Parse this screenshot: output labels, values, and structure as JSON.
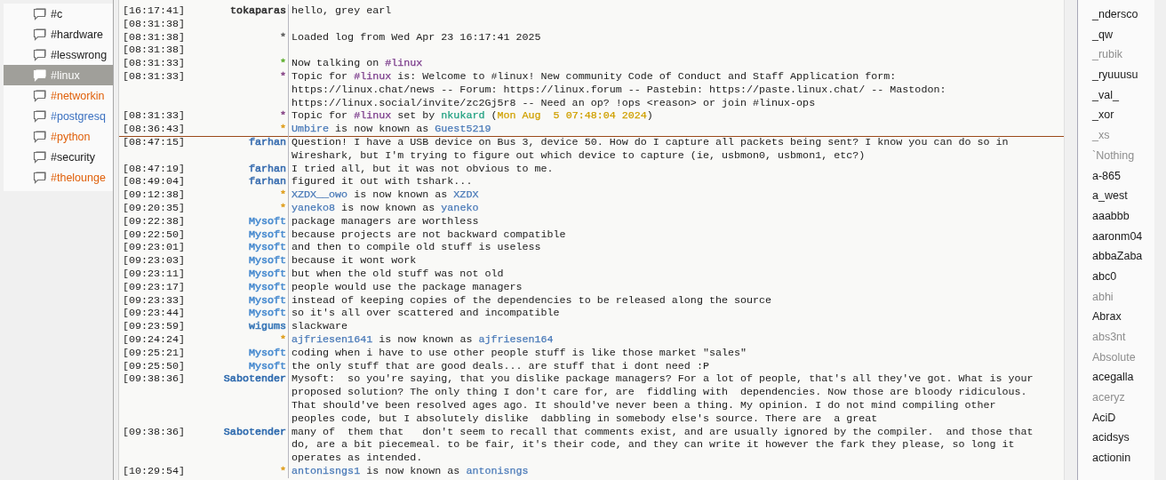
{
  "channels": [
    {
      "name": "#c",
      "selected": false
    },
    {
      "name": "#hardware",
      "selected": false
    },
    {
      "name": "#lesswrong",
      "selected": false
    },
    {
      "name": "#linux",
      "selected": true
    },
    {
      "name": "#networkin",
      "selected": false,
      "color": "#e0600a"
    },
    {
      "name": "#postgresq",
      "selected": false,
      "color": "#3a70c0"
    },
    {
      "name": "#python",
      "selected": false,
      "color": "#e0600a"
    },
    {
      "name": "#security",
      "selected": false
    },
    {
      "name": "#thelounge",
      "selected": false,
      "color": "#e0600a"
    }
  ],
  "chat": {
    "rows": [
      {
        "time": "[16:17:41]",
        "nick": {
          "name": "tokaparas",
          "color": "#303030"
        },
        "message": [
          {
            "text": "hello, grey earl"
          }
        ],
        "read_marker": false
      },
      {
        "time": "[08:31:38]",
        "read_marker": false
      },
      {
        "time": "[08:31:38]",
        "nick": {
          "name": "*",
          "color": "#606060"
        },
        "message": [
          {
            "text": "Loaded log from Wed Apr 23 16:17:41 2025"
          }
        ],
        "read_marker": false
      },
      {
        "time": "[08:31:38]",
        "read_marker": false
      },
      {
        "time": "[08:31:33]",
        "nick": {
          "name": "*",
          "color": "#60b030"
        },
        "message": [
          {
            "text": "Now talking on "
          },
          {
            "text": "#linux",
            "color": "#7a3a8a"
          }
        ],
        "read_marker": false
      },
      {
        "time": "[08:31:33]",
        "nick": {
          "name": "*",
          "color": "#8a4a8a"
        },
        "message": [
          {
            "text": "Topic for "
          },
          {
            "text": "#linux",
            "color": "#7a3a8a"
          },
          {
            "text": " is: Welcome to #linux! New community Code of Conduct and Staff Application form:\nhttps://linux.chat/news -- Forum: https://linux.forum -- Pastebin: https://paste.linux.chat/ -- Mastodon:\nhttps://linux.social/invite/zc2Gj5r8 -- Need an op? !ops <reason> or join #linux-ops"
          }
        ],
        "read_marker": false
      },
      {
        "time": "[08:31:33]",
        "nick": {
          "name": "*",
          "color": "#8a4a8a"
        },
        "message": [
          {
            "text": "Topic for "
          },
          {
            "text": "#linux",
            "color": "#7a3a8a"
          },
          {
            "text": " set by "
          },
          {
            "text": "nkukard",
            "color": "#20a080"
          },
          {
            "text": " ("
          },
          {
            "text": "Mon Aug  5 07:48:04 2024",
            "color": "#d0a000"
          },
          {
            "text": ")"
          }
        ],
        "read_marker": false
      },
      {
        "time": "[08:36:43]",
        "nick": {
          "name": "*",
          "color": "#e0a020"
        },
        "message": [
          {
            "text": "Umbire",
            "color": "#4a7ab8"
          },
          {
            "text": " is now known as "
          },
          {
            "text": "Guest5219",
            "color": "#4a7ab8"
          }
        ],
        "read_marker": true
      },
      {
        "time": "[08:47:15]",
        "nick": {
          "name": "farhan",
          "color": "#3a6eb0"
        },
        "message": [
          {
            "text": "Question! I have a USB device on Bus 3, device 50. How do I capture all packets being sent? I know you can do so in\nWireshark, but I'm trying to figure out which device to capture (ie, usbmon0, usbmon1, etc?)"
          }
        ],
        "read_marker": false
      },
      {
        "time": "[08:47:19]",
        "nick": {
          "name": "farhan",
          "color": "#3a6eb0"
        },
        "message": [
          {
            "text": "I tried all, but it was not obvious to me."
          }
        ],
        "read_marker": false
      },
      {
        "time": "[08:49:04]",
        "nick": {
          "name": "farhan",
          "color": "#3a6eb0"
        },
        "message": [
          {
            "text": "figured it out with tshark..."
          }
        ],
        "read_marker": false
      },
      {
        "time": "[09:12:38]",
        "nick": {
          "name": "*",
          "color": "#e0a020"
        },
        "message": [
          {
            "text": "XZDX__owo",
            "color": "#4a7ab8"
          },
          {
            "text": " is now known as "
          },
          {
            "text": "XZDX",
            "color": "#4a7ab8"
          }
        ],
        "read_marker": false
      },
      {
        "time": "[09:20:35]",
        "nick": {
          "name": "*",
          "color": "#e0a020"
        },
        "message": [
          {
            "text": "yaneko8",
            "color": "#4a7ab8"
          },
          {
            "text": " is now known as "
          },
          {
            "text": "yaneko",
            "color": "#4a7ab8"
          }
        ],
        "read_marker": false
      },
      {
        "time": "[09:22:38]",
        "nick": {
          "name": "Mysoft",
          "color": "#4a8cd0"
        },
        "message": [
          {
            "text": "package managers are worthless"
          }
        ],
        "read_marker": false
      },
      {
        "time": "[09:22:50]",
        "nick": {
          "name": "Mysoft",
          "color": "#4a8cd0"
        },
        "message": [
          {
            "text": "because projects are not backward compatible"
          }
        ],
        "read_marker": false
      },
      {
        "time": "[09:23:01]",
        "nick": {
          "name": "Mysoft",
          "color": "#4a8cd0"
        },
        "message": [
          {
            "text": "and then to compile old stuff is useless"
          }
        ],
        "read_marker": false
      },
      {
        "time": "[09:23:03]",
        "nick": {
          "name": "Mysoft",
          "color": "#4a8cd0"
        },
        "message": [
          {
            "text": "because it wont work"
          }
        ],
        "read_marker": false
      },
      {
        "time": "[09:23:11]",
        "nick": {
          "name": "Mysoft",
          "color": "#4a8cd0"
        },
        "message": [
          {
            "text": "but when the old stuff was not old"
          }
        ],
        "read_marker": false
      },
      {
        "time": "[09:23:17]",
        "nick": {
          "name": "Mysoft",
          "color": "#4a8cd0"
        },
        "message": [
          {
            "text": "people would use the package managers"
          }
        ],
        "read_marker": false
      },
      {
        "time": "[09:23:33]",
        "nick": {
          "name": "Mysoft",
          "color": "#4a8cd0"
        },
        "message": [
          {
            "text": "instead of keeping copies of the dependencies to be released along the source"
          }
        ],
        "read_marker": false
      },
      {
        "time": "[09:23:44]",
        "nick": {
          "name": "Mysoft",
          "color": "#4a8cd0"
        },
        "message": [
          {
            "text": "so it's all over scattered and incompatible"
          }
        ],
        "read_marker": false
      },
      {
        "time": "[09:23:59]",
        "nick": {
          "name": "wigums",
          "color": "#3a78b8"
        },
        "message": [
          {
            "text": "slackware"
          }
        ],
        "read_marker": false
      },
      {
        "time": "[09:24:24]",
        "nick": {
          "name": "*",
          "color": "#e0a020"
        },
        "message": [
          {
            "text": "ajfriesen1641",
            "color": "#4a7ab8"
          },
          {
            "text": " is now known as "
          },
          {
            "text": "ajfriesen164",
            "color": "#4a7ab8"
          }
        ],
        "read_marker": false
      },
      {
        "time": "[09:25:21]",
        "nick": {
          "name": "Mysoft",
          "color": "#4a8cd0"
        },
        "message": [
          {
            "text": "coding when i have to use other people stuff is like those market \"sales\""
          }
        ],
        "read_marker": false
      },
      {
        "time": "[09:25:50]",
        "nick": {
          "name": "Mysoft",
          "color": "#4a8cd0"
        },
        "message": [
          {
            "text": "the only stuff that are good deals... are stuff that i dont need :P"
          }
        ],
        "read_marker": false
      },
      {
        "time": "[09:38:36]",
        "nick": {
          "name": "Sabotender",
          "color": "#2e6aae"
        },
        "message": [
          {
            "text": "Mysoft:  so you're saying, that you dislike package managers? For a lot of people, that's all they've got. What is your\nproposed solution? The only thing I don't care for, are  fiddling with  dependencies. Now those are bloody ridiculous.\nThat should've been resolved ages ago. It should've never been a thing. My opinion. I do not mind compiling other\npeoples code, but I absolutely dislike  dabbling in somebody else's source. There are  a great"
          }
        ],
        "read_marker": false
      },
      {
        "time": "[09:38:36]",
        "nick": {
          "name": "Sabotender",
          "color": "#2e6aae"
        },
        "message": [
          {
            "text": "many of  them that   don't seem to recall that comments exist, and are usually ignored by the compiler.  and those that\ndo, are a bit piecemeal. to be fair, it's their code, and they can write it however the fark they please, so long it\noperates as intended."
          }
        ],
        "read_marker": false
      },
      {
        "time": "[10:29:54]",
        "nick": {
          "name": "*",
          "color": "#e0a020"
        },
        "message": [
          {
            "text": "antonisngs1",
            "color": "#4a7ab8"
          },
          {
            "text": " is now known as "
          },
          {
            "text": "antonisngs",
            "color": "#4a7ab8"
          }
        ],
        "read_marker": false
      }
    ]
  },
  "users": [
    {
      "nick": "_ndersco",
      "away": false
    },
    {
      "nick": "_qw",
      "away": false
    },
    {
      "nick": "_rubik",
      "away": true
    },
    {
      "nick": "_ryuuusu",
      "away": false
    },
    {
      "nick": "_val_",
      "away": false
    },
    {
      "nick": "_xor",
      "away": false
    },
    {
      "nick": "_xs",
      "away": true
    },
    {
      "nick": "`Nothing",
      "away": true
    },
    {
      "nick": "a-865",
      "away": false
    },
    {
      "nick": "a_west",
      "away": false
    },
    {
      "nick": "aaabbb",
      "away": false
    },
    {
      "nick": "aaronm04",
      "away": false
    },
    {
      "nick": "abbaZaba",
      "away": false
    },
    {
      "nick": "abc0",
      "away": false
    },
    {
      "nick": "abhi",
      "away": true
    },
    {
      "nick": "Abrax",
      "away": false
    },
    {
      "nick": "abs3nt",
      "away": true
    },
    {
      "nick": "Absolute",
      "away": true
    },
    {
      "nick": "acegalla",
      "away": false
    },
    {
      "nick": "aceryz",
      "away": true
    },
    {
      "nick": "AciD",
      "away": false
    },
    {
      "nick": "acidsys",
      "away": false
    },
    {
      "nick": "actionin",
      "away": false
    }
  ]
}
